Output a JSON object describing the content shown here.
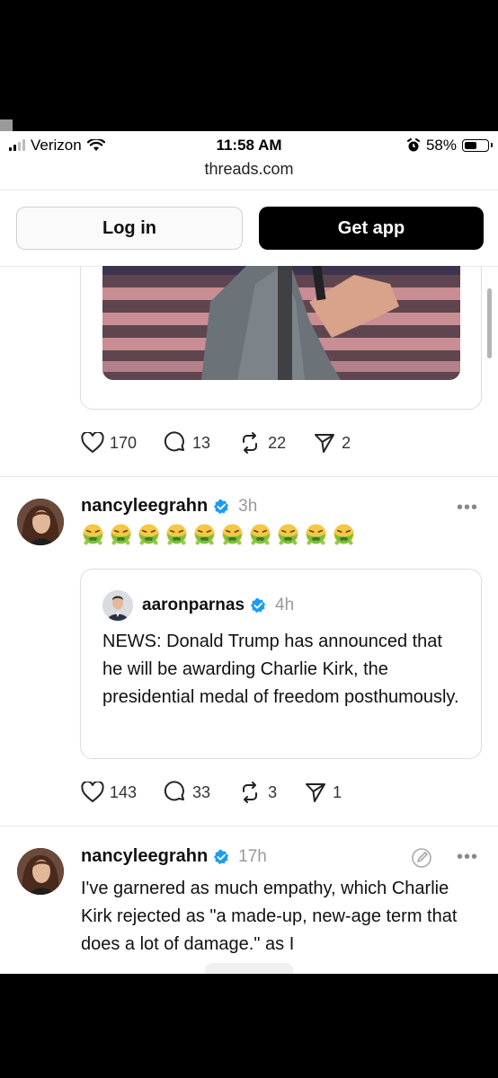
{
  "status_bar": {
    "carrier": "Verizon",
    "time": "11:58 AM",
    "battery": "58%",
    "battery_level": 0.58
  },
  "browser": {
    "url": "threads.com"
  },
  "auth": {
    "login_label": "Log in",
    "get_app_label": "Get app"
  },
  "previous_post": {
    "likes": "170",
    "replies": "13",
    "reposts": "22",
    "shares": "2"
  },
  "post1": {
    "username": "nancyleegrahn",
    "time": "3h",
    "emoji_count": 10,
    "quote": {
      "username": "aaronparnas",
      "time": "4h",
      "text": "NEWS: Donald Trump has announced that he will be awarding Charlie Kirk, the presidential medal of freedom posthumously."
    },
    "likes": "143",
    "replies": "33",
    "reposts": "3",
    "shares": "1"
  },
  "post2": {
    "username": "nancyleegrahn",
    "time": "17h",
    "text": "I've garnered as much empathy, which Charlie Kirk rejected as \"a made-up, new-age term that does a lot of damage.\" as I"
  },
  "more_label": "•••",
  "colors": {
    "verified": "#1d9bf0",
    "muted": "#999999",
    "border": "#dcdcdc"
  },
  "icons": [
    "heart-icon",
    "comment-icon",
    "repost-icon",
    "share-icon",
    "verified-icon",
    "more-icon",
    "nauseated-face-icon",
    "edit-icon"
  ]
}
